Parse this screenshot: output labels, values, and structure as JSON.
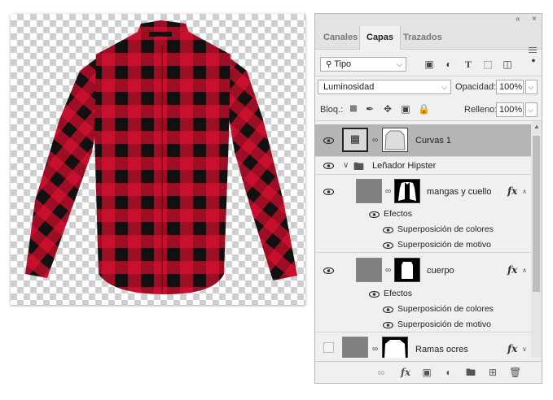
{
  "panel": {
    "collapse_icon": "double-chevron-left-icon",
    "close_icon": "close-icon",
    "tabs": [
      {
        "label": "Canales",
        "active": false
      },
      {
        "label": "Capas",
        "active": true
      },
      {
        "label": "Trazados",
        "active": false
      }
    ],
    "filter": {
      "label": "Tipo"
    },
    "blend_mode": "Luminosidad",
    "opacity_label": "Opacidad:",
    "opacity_value": "100%",
    "lock_label": "Bloq.:",
    "fill_label": "Relleno:",
    "fill_value": "100%"
  },
  "layers": {
    "curvas": {
      "name": "Curvas 1",
      "selected": true
    },
    "group": {
      "name": "Leñador Hipster"
    },
    "mangas": {
      "name": "mangas y cuello",
      "fx": "fx",
      "effects_label": "Efectos",
      "effects": [
        "Superposición de colores",
        "Superposición de motivo"
      ]
    },
    "cuerpo": {
      "name": "cuerpo",
      "fx": "fx",
      "effects_label": "Efectos",
      "effects": [
        "Superposición de colores",
        "Superposición de motivo"
      ]
    },
    "ramas": {
      "name": "Ramas ocres",
      "fx": "fx",
      "visible": false
    }
  },
  "colors": {
    "shirt_red": "#c8102e",
    "shirt_black": "#111111",
    "selected_row": "#b5b5b5"
  }
}
